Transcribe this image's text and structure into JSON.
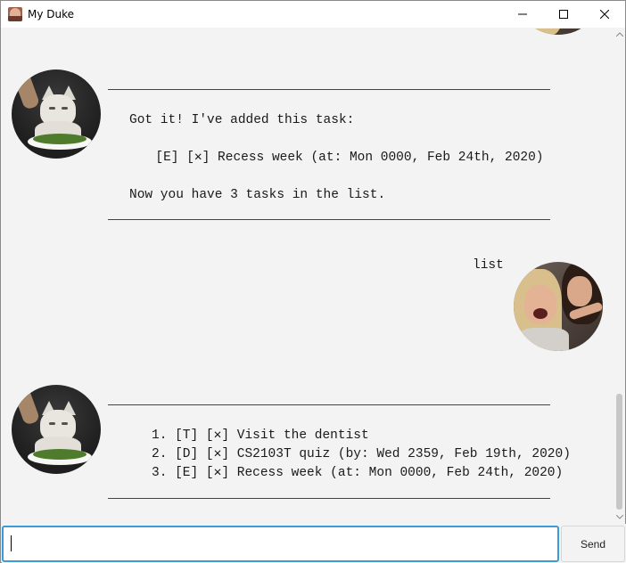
{
  "window": {
    "title": "My Duke"
  },
  "conversation": [
    {
      "speaker": "duke",
      "avatar_icon": "cat-avatar-icon",
      "lines": [
        "Got it! I've added this task:",
        "  [E] [✕] Recess week (at: Mon 0000, Feb 24th, 2020)",
        "Now you have 3 tasks in the list."
      ]
    },
    {
      "speaker": "user",
      "avatar_icon": "woman-yelling-avatar-icon",
      "text": "list"
    },
    {
      "speaker": "duke",
      "avatar_icon": "cat-avatar-icon",
      "lines": [
        "1. [T] [✕] Visit the dentist",
        "2. [D] [✕] CS2103T quiz (by: Wed 2359, Feb 19th, 2020)",
        "3. [E] [✕] Recess week (at: Mon 0000, Feb 24th, 2020)"
      ]
    }
  ],
  "input": {
    "value": "",
    "placeholder": ""
  },
  "send_button": {
    "label": "Send"
  },
  "colors": {
    "background": "#f3f3f3",
    "input_focus_border": "#3c9ad8"
  }
}
